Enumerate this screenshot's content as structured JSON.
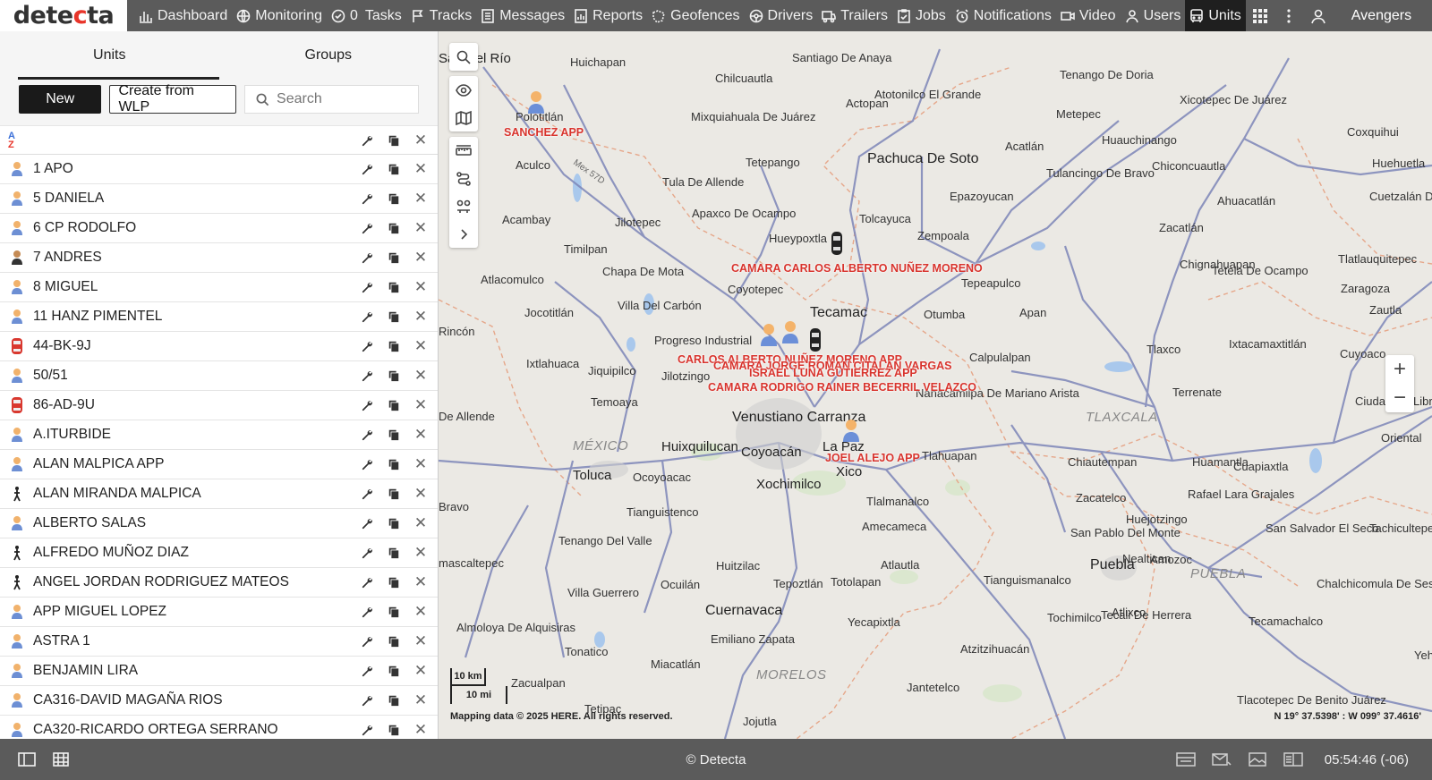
{
  "app": {
    "logo_prefix": "dete",
    "logo_accent": "c",
    "logo_suffix": "ta",
    "brand_color": "#e8352a"
  },
  "nav": {
    "items": [
      {
        "label": "Dashboard",
        "icon": "bar-chart-icon"
      },
      {
        "label": "Monitoring",
        "icon": "globe-icon"
      },
      {
        "label": "Tasks",
        "icon": "check-circle-icon",
        "badge": "0"
      },
      {
        "label": "Tracks",
        "icon": "flag-icon"
      },
      {
        "label": "Messages",
        "icon": "message-list-icon"
      },
      {
        "label": "Reports",
        "icon": "report-icon"
      },
      {
        "label": "Geofences",
        "icon": "geofence-icon"
      },
      {
        "label": "Drivers",
        "icon": "steering-wheel-icon"
      },
      {
        "label": "Trailers",
        "icon": "trailer-icon"
      },
      {
        "label": "Jobs",
        "icon": "clipboard-check-icon"
      },
      {
        "label": "Notifications",
        "icon": "alarm-clock-icon"
      },
      {
        "label": "Video",
        "icon": "video-camera-icon"
      },
      {
        "label": "Users",
        "icon": "user-icon"
      },
      {
        "label": "Units",
        "icon": "bus-icon",
        "active": true
      }
    ],
    "username": "Avengers"
  },
  "panel": {
    "tabs": [
      "Units",
      "Groups"
    ],
    "active_tab": "Units",
    "new_button": "New",
    "create_wlp_button": "Create from WLP",
    "search_placeholder": "Search",
    "sort_label": "A-Z",
    "units": [
      {
        "name": "1 APO",
        "icon": "person"
      },
      {
        "name": "5 DANIELA",
        "icon": "person"
      },
      {
        "name": "6 CP RODOLFO",
        "icon": "person"
      },
      {
        "name": "7 ANDRES",
        "icon": "person-dark"
      },
      {
        "name": "8 MIGUEL",
        "icon": "person"
      },
      {
        "name": "11 HANZ PIMENTEL",
        "icon": "person"
      },
      {
        "name": "44-BK-9J",
        "icon": "bus"
      },
      {
        "name": "50/51",
        "icon": "person"
      },
      {
        "name": "86-AD-9U",
        "icon": "bus"
      },
      {
        "name": "A.ITURBIDE",
        "icon": "person"
      },
      {
        "name": "ALAN MALPICA APP",
        "icon": "person"
      },
      {
        "name": "ALAN MIRANDA MALPICA",
        "icon": "walker"
      },
      {
        "name": "ALBERTO SALAS",
        "icon": "person"
      },
      {
        "name": "ALFREDO MUÑOZ DIAZ",
        "icon": "walker"
      },
      {
        "name": "ANGEL JORDAN RODRIGUEZ MATEOS",
        "icon": "walker"
      },
      {
        "name": "APP MIGUEL LOPEZ",
        "icon": "person"
      },
      {
        "name": "ASTRA 1",
        "icon": "person"
      },
      {
        "name": "BENJAMIN LIRA",
        "icon": "person"
      },
      {
        "name": "CA316-DAVID MAGAÑA RIOS",
        "icon": "person"
      },
      {
        "name": "CA320-RICARDO ORTEGA SERRANO",
        "icon": "person"
      }
    ]
  },
  "map": {
    "places": [
      {
        "name": "San Del Río",
        "cls": "city"
      },
      {
        "name": "Huichapan"
      },
      {
        "name": "Santiago De Anaya"
      },
      {
        "name": "Tenango De Doria"
      },
      {
        "name": "Chilcuautla"
      },
      {
        "name": "Atotonilco El Grande"
      },
      {
        "name": "Xicotepec De Juárez"
      },
      {
        "name": "Actopan"
      },
      {
        "name": "Polotitlán"
      },
      {
        "name": "Mixquiahuala De Juárez"
      },
      {
        "name": "Metepec"
      },
      {
        "name": "Coxquihui"
      },
      {
        "name": "Acatlán"
      },
      {
        "name": "Huauchinango"
      },
      {
        "name": "Huehuetla"
      },
      {
        "name": "Pachuca De Soto",
        "cls": "big"
      },
      {
        "name": "Aculco"
      },
      {
        "name": "Tetepango"
      },
      {
        "name": "Tulancingo De Bravo"
      },
      {
        "name": "Chiconcuautla"
      },
      {
        "name": "Tula De Allende"
      },
      {
        "name": "Epazoyucan"
      },
      {
        "name": "Ahuacatlán"
      },
      {
        "name": "Cuetzalán Del Progreso"
      },
      {
        "name": "Acambay"
      },
      {
        "name": "Jilotepec"
      },
      {
        "name": "Apaxco De Ocampo"
      },
      {
        "name": "Tolcayuca"
      },
      {
        "name": "Zacatlán"
      },
      {
        "name": "Hueypoxtla"
      },
      {
        "name": "Zempoala"
      },
      {
        "name": "Timilpan"
      },
      {
        "name": "Chignahuapan"
      },
      {
        "name": "Tlatlauquitepec"
      },
      {
        "name": "Chapa De Mota"
      },
      {
        "name": "Tetela De Ocampo"
      },
      {
        "name": "Atlacomulco"
      },
      {
        "name": "Coyotepec"
      },
      {
        "name": "Tepeapulco"
      },
      {
        "name": "Zaragoza"
      },
      {
        "name": "Villa Del Carbón"
      },
      {
        "name": "Jocotitlán"
      },
      {
        "name": "Tecamac",
        "cls": "big"
      },
      {
        "name": "Otumba"
      },
      {
        "name": "Apan"
      },
      {
        "name": "Zautla"
      },
      {
        "name": "Rincón"
      },
      {
        "name": "Progreso Industrial"
      },
      {
        "name": "Ixtacamaxtitlán"
      },
      {
        "name": "Ixtlahuaca"
      },
      {
        "name": "Jiquipilco"
      },
      {
        "name": "Calpulalpan"
      },
      {
        "name": "Tlaxco"
      },
      {
        "name": "Cuyoaco"
      },
      {
        "name": "Jilotzingo"
      },
      {
        "name": "Nanacamilpa De Mariano Arista"
      },
      {
        "name": "Terrenate"
      },
      {
        "name": "Ciudad De Libres"
      },
      {
        "name": "Temoaya"
      },
      {
        "name": "Venustiano Carranza",
        "cls": "big"
      },
      {
        "name": "TLAXCALA",
        "cls": "region"
      },
      {
        "name": "De Allende"
      },
      {
        "name": "MÉXICO",
        "cls": "region"
      },
      {
        "name": "Huixquilucan",
        "cls": "city"
      },
      {
        "name": "Coyoacán",
        "cls": "city"
      },
      {
        "name": "La Paz",
        "cls": "city"
      },
      {
        "name": "Oriental"
      },
      {
        "name": "Toluca",
        "cls": "city"
      },
      {
        "name": "Ocoyoacac"
      },
      {
        "name": "Tlahuapan"
      },
      {
        "name": "Chiautempan"
      },
      {
        "name": "Huamantla"
      },
      {
        "name": "Cuapiaxtla"
      },
      {
        "name": "Xico",
        "cls": "city"
      },
      {
        "name": "Xochimilco",
        "cls": "city"
      },
      {
        "name": "Zacatelco"
      },
      {
        "name": "Rafael Lara Grajales"
      },
      {
        "name": "Bravo"
      },
      {
        "name": "Tianguistenco"
      },
      {
        "name": "Tlalmanalco"
      },
      {
        "name": "Huejotzingo"
      },
      {
        "name": "Amecameca"
      },
      {
        "name": "San Pablo Del Monte"
      },
      {
        "name": "San Salvador El Seco"
      },
      {
        "name": "Tachicultepec"
      },
      {
        "name": "Tenango Del Valle"
      },
      {
        "name": "Nealtican"
      },
      {
        "name": "Puebla",
        "cls": "big"
      },
      {
        "name": "Amozoc"
      },
      {
        "name": "PUEBLA",
        "cls": "region"
      },
      {
        "name": "mascaltepec"
      },
      {
        "name": "Huitzilac"
      },
      {
        "name": "Atlautla"
      },
      {
        "name": "Tianguismanalco"
      },
      {
        "name": "Chalchicomula De Sesma"
      },
      {
        "name": "Villa Guerrero"
      },
      {
        "name": "Ocuilán"
      },
      {
        "name": "Tepoztlán"
      },
      {
        "name": "Totolapan"
      },
      {
        "name": "Cuernavaca",
        "cls": "big"
      },
      {
        "name": "Atlixco"
      },
      {
        "name": "Tochimilco"
      },
      {
        "name": "Tecali De Herrera"
      },
      {
        "name": "Tecamachalco"
      },
      {
        "name": "Yecapixtla"
      },
      {
        "name": "Almoloya De Alquisiras"
      },
      {
        "name": "Emiliano Zapata"
      },
      {
        "name": "Atzitzihuacán"
      },
      {
        "name": "Yehualtepec"
      },
      {
        "name": "Tonatico"
      },
      {
        "name": "Miacatlán"
      },
      {
        "name": "MORELOS",
        "cls": "region"
      },
      {
        "name": "Zacualpan"
      },
      {
        "name": "Jantetelco"
      },
      {
        "name": "Tlacotepec De Benito Juárez"
      },
      {
        "name": "Tetipac"
      },
      {
        "name": "Jojutla"
      }
    ],
    "unit_tags": [
      "SANCHEZ APP",
      "CAMARA CARLOS ALBERTO NUÑEZ MORENO",
      "CARLOS ALBERTO NUÑEZ MORENO APP",
      "CAMARA JORGE ROMAN CITALAN VARGAS",
      "ISRAEL LUNA GUTIERREZ APP",
      "CAMARA RODRIGO RAINER BECERRIL VELAZCO",
      "JOEL ALEJO APP"
    ],
    "scale_km": "10 km",
    "scale_mi": "10 mi",
    "copyright": "Mapping data © 2025 HERE. All rights reserved.",
    "coordinates": "N 19° 37.5398' : W 099° 37.4616'",
    "zoom_in": "+",
    "zoom_out": "−",
    "highway_label": "Mex 57D"
  },
  "footer": {
    "copyright": "© Detecta",
    "clock": "05:54:46 (-06)"
  }
}
